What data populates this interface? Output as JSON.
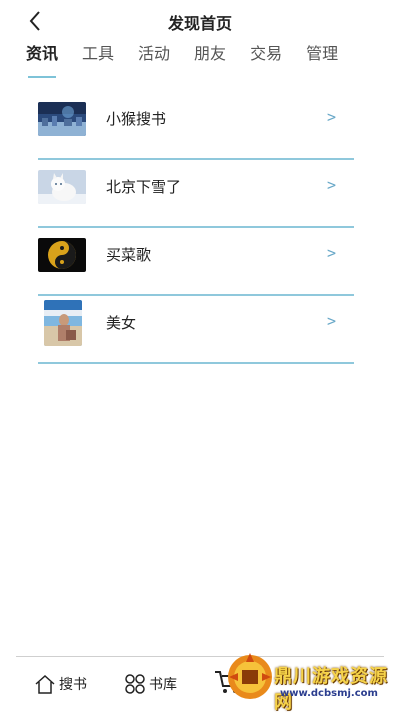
{
  "header": {
    "title": "发现首页",
    "back_icon": "back-arrow-icon"
  },
  "tabs": [
    {
      "label": "资讯",
      "active": true
    },
    {
      "label": "工具",
      "active": false
    },
    {
      "label": "活动",
      "active": false
    },
    {
      "label": "朋友",
      "active": false
    },
    {
      "label": "交易",
      "active": false
    },
    {
      "label": "管理",
      "active": false
    }
  ],
  "list": [
    {
      "label": "小猴搜书",
      "thumb": "night-city-thumbnail",
      "chevron": ">"
    },
    {
      "label": "北京下雪了",
      "thumb": "white-cat-thumbnail",
      "chevron": ">"
    },
    {
      "label": "买菜歌",
      "thumb": "yin-yang-thumbnail",
      "chevron": ">"
    },
    {
      "label": "美女",
      "thumb": "beach-photo-thumbnail",
      "chevron": ">"
    }
  ],
  "bottom_nav": [
    {
      "label": "搜书",
      "icon": "home-icon"
    },
    {
      "label": "书库",
      "icon": "library-icon"
    },
    {
      "label": "",
      "icon": "cart-icon"
    }
  ],
  "watermark": {
    "name": "鼎川游戏资源网",
    "url": "www.dcbsmj.com"
  },
  "colors": {
    "accent_line": "#8fc8dc",
    "chevron": "#68a8c8"
  }
}
